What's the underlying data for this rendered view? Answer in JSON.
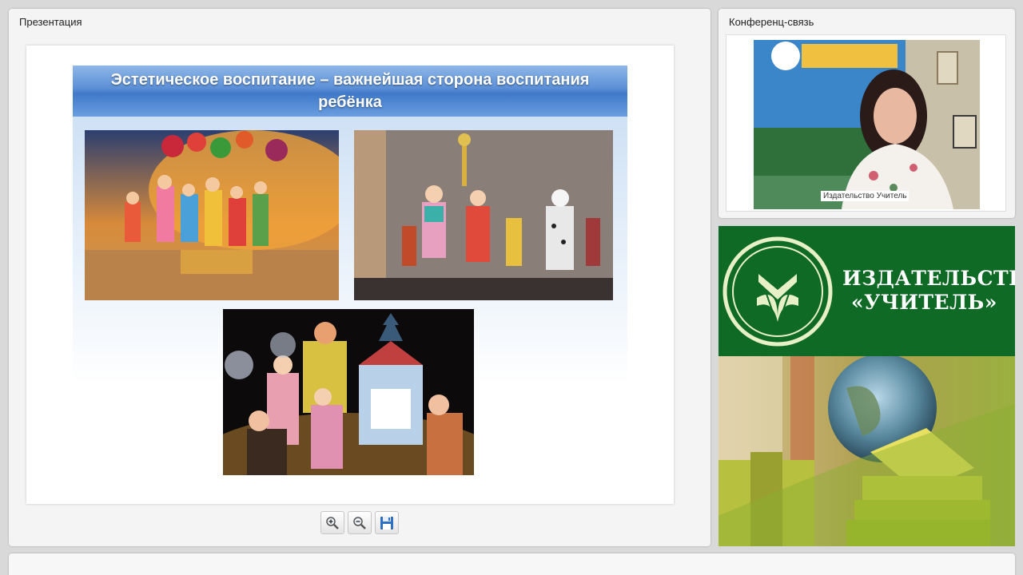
{
  "presentation": {
    "title": "Презентация",
    "slide": {
      "title": "Эстетическое воспитание – важнейшая сторона воспитания ребёнка"
    },
    "toolbar": {
      "zoom_in_icon": "zoom-in-icon",
      "zoom_out_icon": "zoom-out-icon",
      "save_icon": "save-icon"
    }
  },
  "conference": {
    "title": "Конференц-связь",
    "video_label": "Издательство Учитель"
  },
  "banner": {
    "logo_line1": "ИЗДАТЕЛЬСТВО",
    "logo_line2": "«УЧИТЕЛЬ»"
  },
  "colors": {
    "slide_header": "#4a82cf",
    "banner_green": "#0e6a24",
    "panel_bg": "#f4f4f4"
  }
}
